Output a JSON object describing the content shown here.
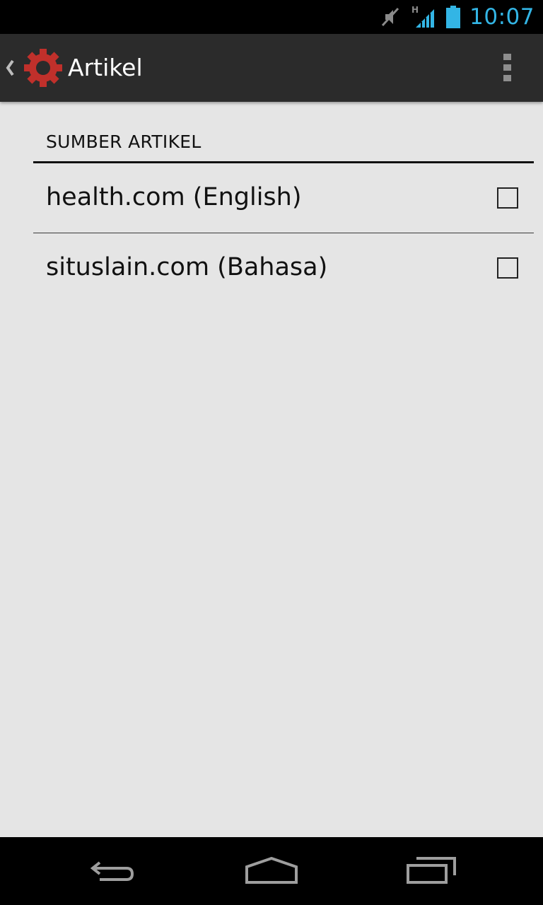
{
  "status_bar": {
    "time": "10:07",
    "network_type": "H",
    "icons": [
      "mute-icon",
      "signal-icon",
      "battery-icon"
    ],
    "clock_color": "#33b5e5"
  },
  "action_bar": {
    "title": "Artikel",
    "app_icon": "gear-icon",
    "app_icon_color": "#c0302b",
    "overflow_icon": "overflow-menu-icon"
  },
  "preferences": {
    "category_title": "SUMBER ARTIKEL",
    "items": [
      {
        "label": "health.com (English)",
        "checked": false
      },
      {
        "label": "situslain.com (Bahasa)",
        "checked": false
      }
    ]
  },
  "nav_bar": {
    "icons": [
      "back-icon",
      "home-icon",
      "recents-icon"
    ]
  }
}
